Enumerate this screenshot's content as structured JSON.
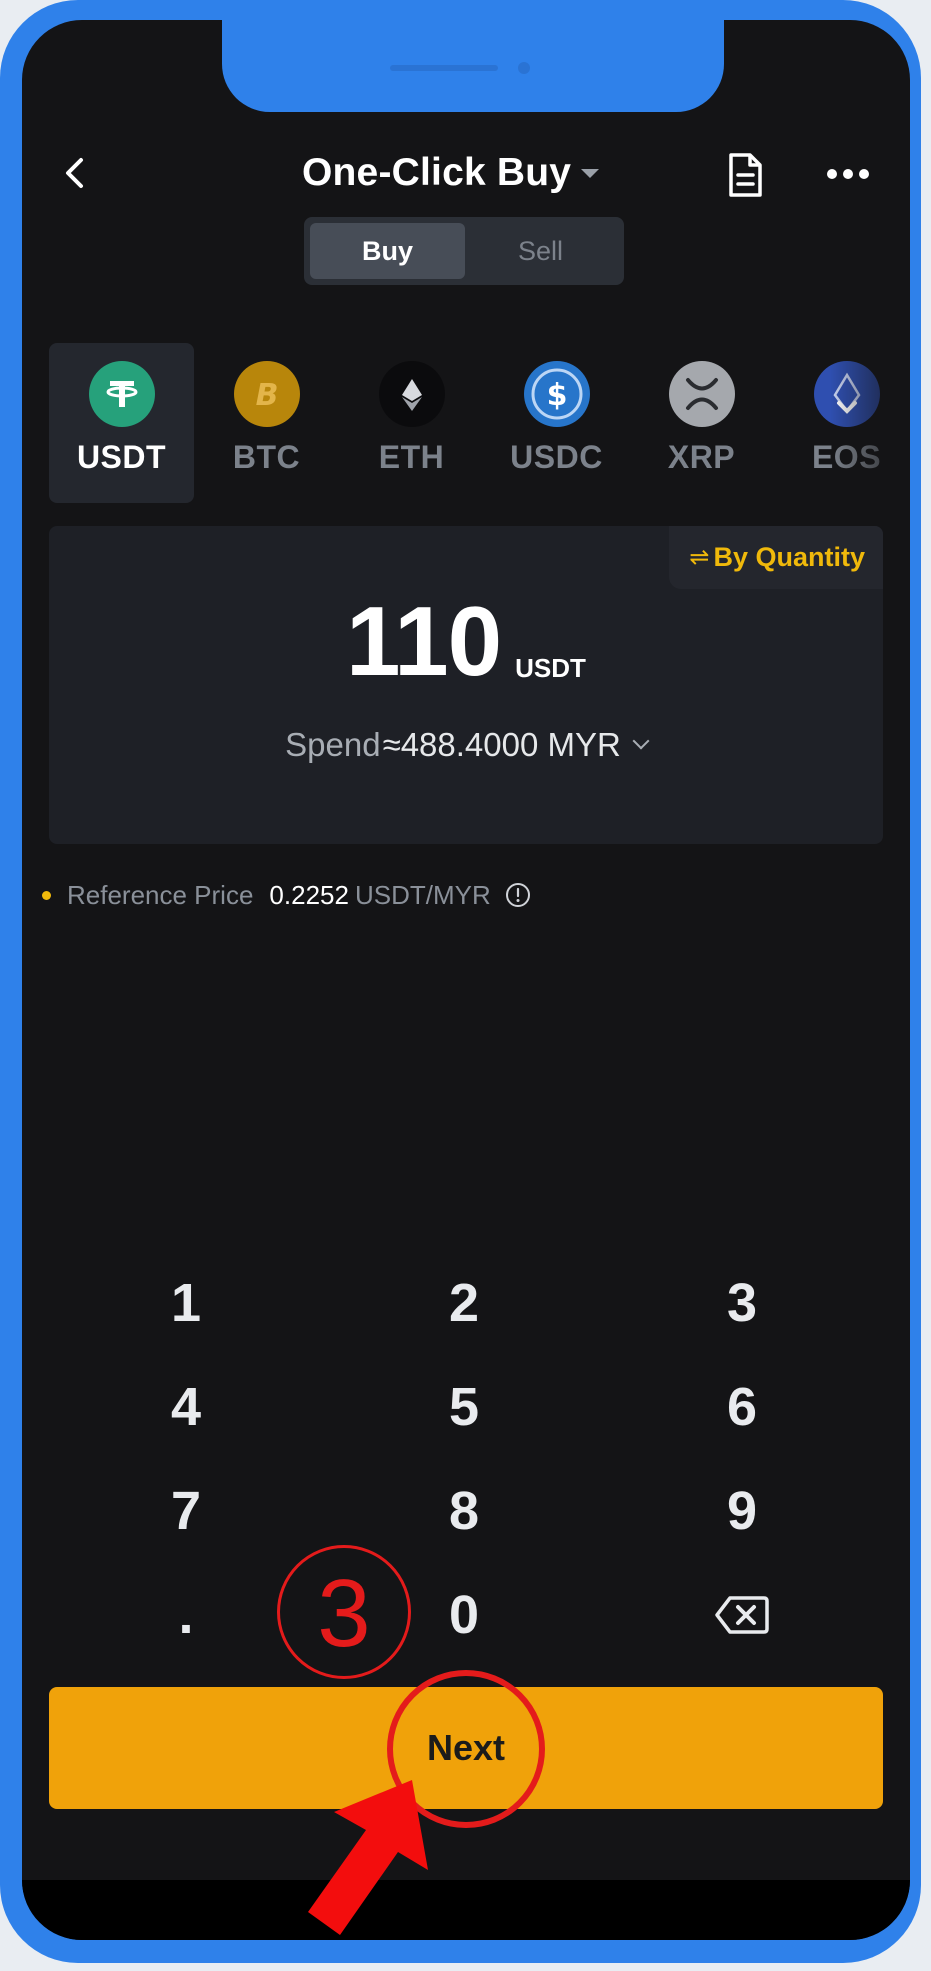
{
  "header": {
    "title": "One-Click Buy"
  },
  "toggle": {
    "buy_label": "Buy",
    "sell_label": "Sell",
    "selected": "Buy"
  },
  "coins": [
    {
      "symbol": "USDT",
      "color": "#26a17b",
      "icon": "tether-icon",
      "selected": true
    },
    {
      "symbol": "BTC",
      "color": "#b8860b",
      "icon": "bitcoin-icon",
      "selected": false
    },
    {
      "symbol": "ETH",
      "color": "#0b0b0d",
      "icon": "ethereum-icon",
      "selected": false
    },
    {
      "symbol": "USDC",
      "color": "#2775ca",
      "icon": "usdc-icon",
      "selected": false
    },
    {
      "symbol": "XRP",
      "color": "#a5a8ad",
      "icon": "xrp-icon",
      "selected": false
    },
    {
      "symbol": "EOS",
      "color": "#2f4fb0",
      "icon": "eos-icon",
      "selected": false
    }
  ],
  "amount_card": {
    "mode_icon": "⇌",
    "mode_label": "By Quantity",
    "amount": "110",
    "unit": "USDT",
    "spend_label": "Spend",
    "spend_value": "≈488.4000 MYR"
  },
  "reference": {
    "label": "Reference Price",
    "value": "0.2252",
    "unit": "USDT/MYR"
  },
  "keypad": {
    "keys": [
      "1",
      "2",
      "3",
      "4",
      "5",
      "6",
      "7",
      "8",
      "9",
      ".",
      "0",
      "⌫"
    ]
  },
  "next_button": {
    "label": "Next"
  },
  "annotation": {
    "step_number": "3",
    "color": "#e41b1b"
  },
  "colors": {
    "accent": "#f0b90b",
    "button": "#f0a20a",
    "background": "#141416",
    "frame": "#2f81ea"
  }
}
